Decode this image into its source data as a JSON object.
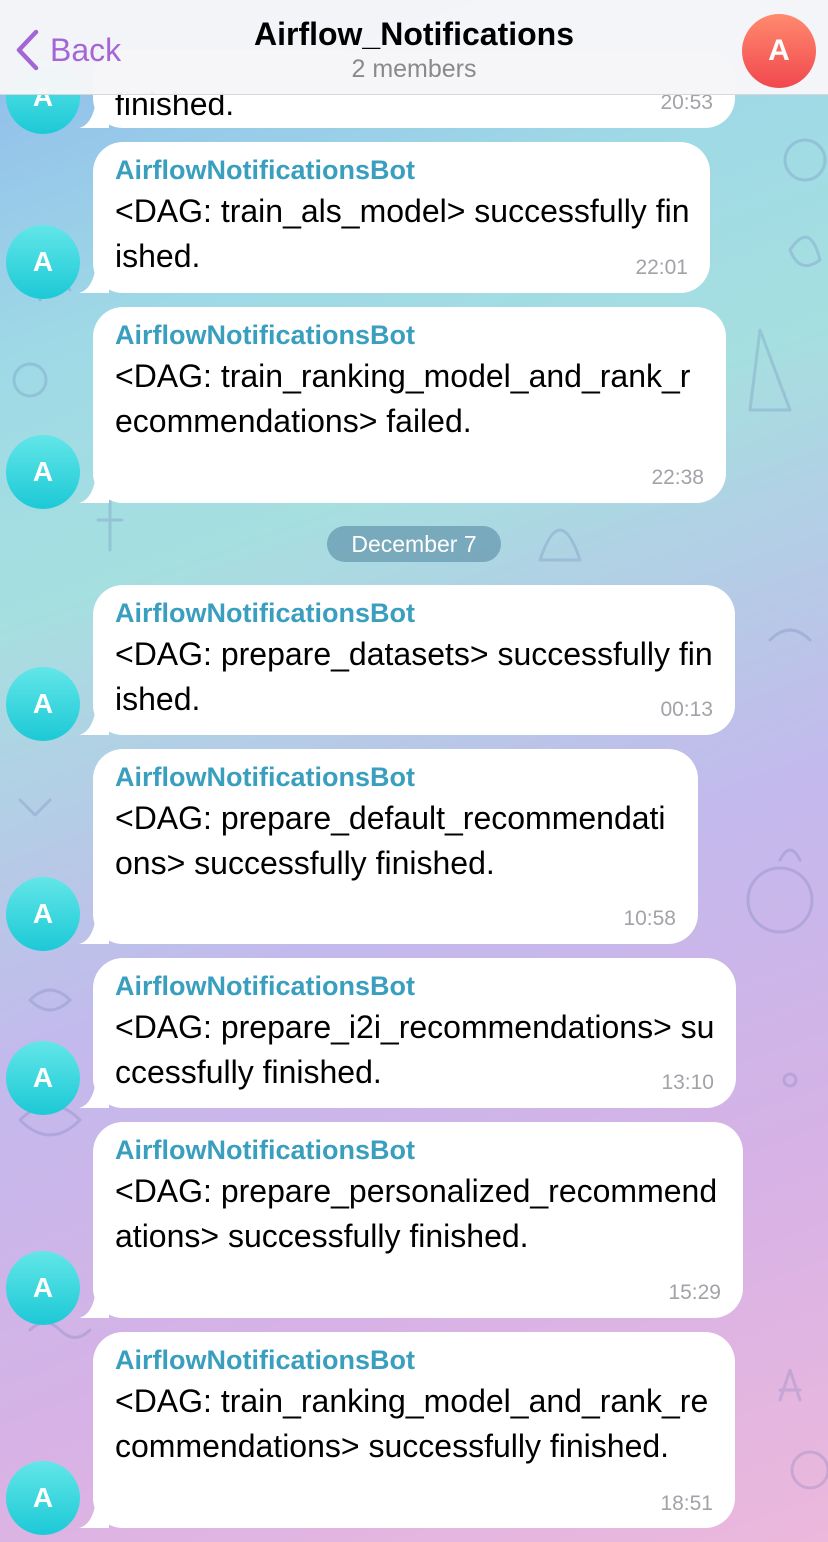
{
  "header": {
    "back_label": "Back",
    "title": "Airflow_Notifications",
    "subtitle": "2 members",
    "avatar_initial": "A",
    "avatar_color": "#f5564e",
    "accent_color": "#a466d6"
  },
  "chat": {
    "date_separator": "December 7",
    "sender_color": "#3a9fbf",
    "avatar_color": "#22cbd8",
    "messages": [
      {
        "sender": "",
        "text": "finished.",
        "time": "20:53",
        "avatar": "A"
      },
      {
        "sender": "AirflowNotificationsBot",
        "text": "<DAG: train_als_model> successfully finished.",
        "time": "22:01",
        "avatar": "A"
      },
      {
        "sender": "AirflowNotificationsBot",
        "text": "<DAG: train_ranking_model_and_rank_recommendations> failed.",
        "time": "22:38",
        "avatar": "A"
      },
      {
        "sender": "AirflowNotificationsBot",
        "text": "<DAG: prepare_datasets> successfully finished.",
        "time": "00:13",
        "avatar": "A"
      },
      {
        "sender": "AirflowNotificationsBot",
        "text": "<DAG: prepare_default_recommendations> successfully finished.",
        "time": "10:58",
        "avatar": "A"
      },
      {
        "sender": "AirflowNotificationsBot",
        "text": "<DAG: prepare_i2i_recommendations> successfully finished.",
        "time": "13:10",
        "avatar": "A"
      },
      {
        "sender": "AirflowNotificationsBot",
        "text": "<DAG: prepare_personalized_recommendations> successfully finished.",
        "time": "15:29",
        "avatar": "A"
      },
      {
        "sender": "AirflowNotificationsBot",
        "text": "<DAG: train_ranking_model_and_rank_recommendations> successfully finished.",
        "time": "18:51",
        "avatar": "A"
      }
    ]
  }
}
